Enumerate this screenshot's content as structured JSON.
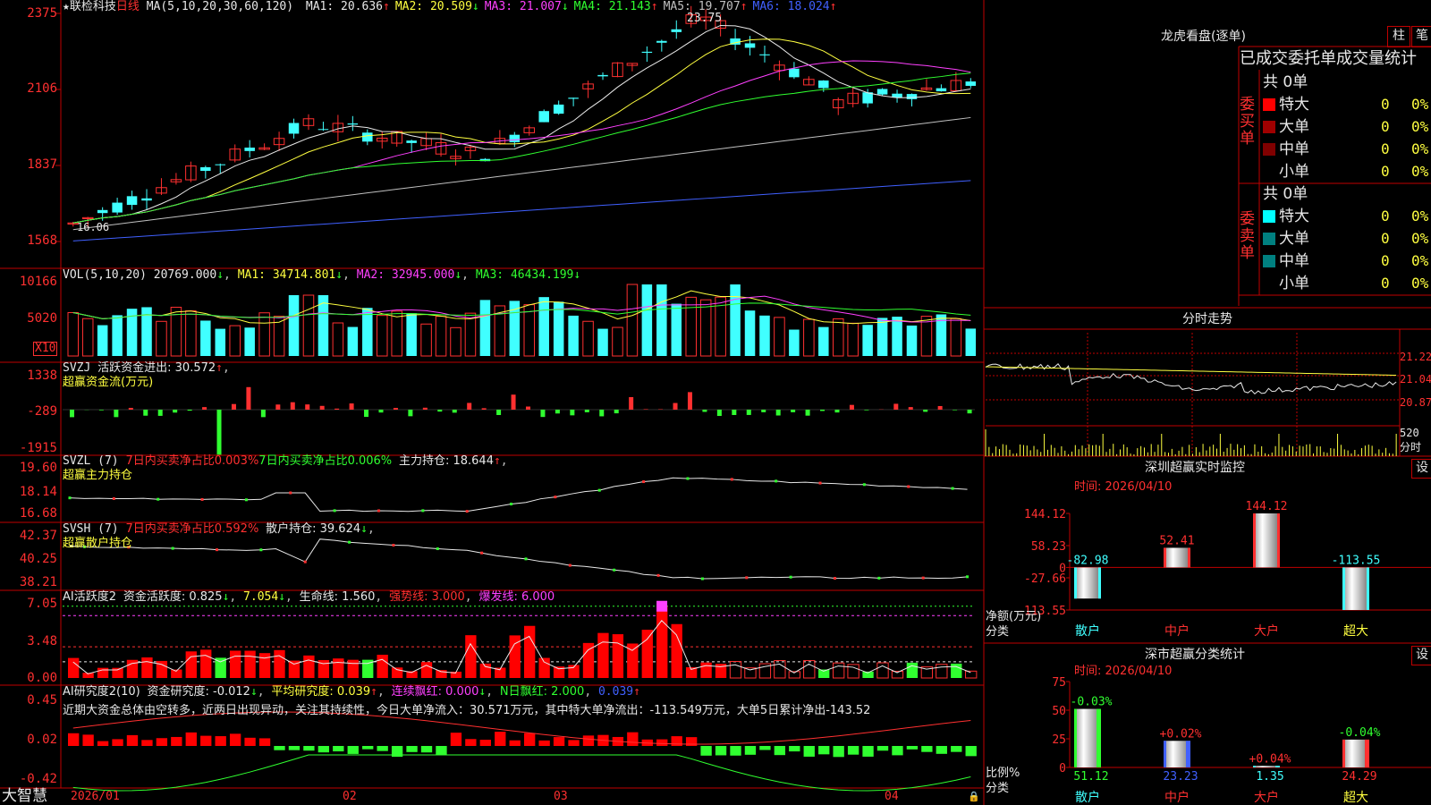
{
  "stock": {
    "star": "★",
    "name": "联检科技",
    "period": "日线",
    "ma_title": "MA(5,10,20,30,60,120)",
    "ma": [
      {
        "label": "MA1: 20.636",
        "arrow": "↑",
        "color": "#e8e8e8"
      },
      {
        "label": "MA2: 20.509",
        "arrow": "↓",
        "color": "#ffff40"
      },
      {
        "label": "MA3: 21.007",
        "arrow": "↓",
        "color": "#ff40ff"
      },
      {
        "label": "MA4: 21.143",
        "arrow": "↑",
        "color": "#30ff30"
      },
      {
        "label": "MA5: 19.707",
        "arrow": "↑",
        "color": "#c0c0c0"
      },
      {
        "label": "MA6: 18.024",
        "arrow": "↑",
        "color": "#4060ff"
      }
    ],
    "high_label": "23.75",
    "low_label": "16.06"
  },
  "vol": {
    "title": "VOL(5,10,20)",
    "value": "20769.000",
    "value_arrow": "↓",
    "ma1": "MA1: 34714.801",
    "ma1_arrow": "↓",
    "ma2": "MA2: 32945.000",
    "ma2_arrow": "↓",
    "ma3": "MA3: 46434.199",
    "ma3_arrow": "↓",
    "unit": "X10"
  },
  "svzj": {
    "title": "SVZJ",
    "label": "活跃资金进出: 30.572",
    "arrow": "↑",
    "sub": "超赢资金流(万元)"
  },
  "svzl": {
    "title": "SVZL (7)",
    "t1": "7日内买卖净占比0.003%",
    "t2": "7日内买卖净占比0.006%",
    "t3": "主力持仓: 18.644",
    "arrow": "↑",
    "sub": "超赢主力持仓"
  },
  "svsh": {
    "title": "SVSH (7)",
    "t1": "7日内买卖净占比0.592%",
    "t2": "散户持仓: 39.624",
    "arrow": "↓",
    "sub": "超赢散户持仓"
  },
  "ai1": {
    "title": "AI活跃度2",
    "t1": "资金活跃度: 0.825",
    "a1": "↓",
    "t2": "7.054",
    "a2": "↓",
    "t3": "生命线: 1.560",
    "t4": "强势线: 3.000",
    "t5": "爆发线: 6.000"
  },
  "ai2": {
    "title": "AI研究度2(10)",
    "t1": "资金研究度: -0.012",
    "a1": "↓",
    "t2": "平均研究度: 0.039",
    "a2": "↑",
    "t3": "连续飘红: 0.000",
    "a3": "↓",
    "t4": "N日飘红: 2.000",
    "t5": "0.039",
    "a5": "↑",
    "desc": "近期大资金总体由空转多，近两日出现异动，关注其持续性，今日大单净流入：30.571万元，其中特大单净流出：-113.549万元，大单5日累计净出-143.52"
  },
  "axes": {
    "price": [
      "2375",
      "2106",
      "1837",
      "1568"
    ],
    "vol": [
      "10166",
      "5020"
    ],
    "svzj": [
      "1338",
      "-289",
      "-1915"
    ],
    "svzl": [
      "19.60",
      "18.14",
      "16.68"
    ],
    "svsh": [
      "42.37",
      "40.25",
      "38.21"
    ],
    "ai1": [
      "7.05",
      "3.48",
      "0.00"
    ],
    "ai2": [
      "0.45",
      "0.02",
      "-0.42"
    ]
  },
  "dates": {
    "d1": "2026/01",
    "d2": "02",
    "d3": "03",
    "d4": "04"
  },
  "brand": "大智慧",
  "right": {
    "lhb_title": "龙虎看盘(逐单)",
    "btn_zhu": "柱",
    "btn_bi": "笔",
    "table_title": "已成交委托单成交量统计",
    "buy_side": "委买单",
    "sell_side": "委卖单",
    "buy_total": "共 0单",
    "sell_total": "共 0单",
    "buy_rows": [
      {
        "label": "特大",
        "count": "0",
        "pct": "0%",
        "color": "#ff0000"
      },
      {
        "label": "大单",
        "count": "0",
        "pct": "0%",
        "color": "#a00000"
      },
      {
        "label": "中单",
        "count": "0",
        "pct": "0%",
        "color": "#800000"
      },
      {
        "label": "小单",
        "count": "0",
        "pct": "0%",
        "color": ""
      }
    ],
    "sell_rows": [
      {
        "label": "特大",
        "count": "0",
        "pct": "0%",
        "color": "#00ffff"
      },
      {
        "label": "大单",
        "count": "0",
        "pct": "0%",
        "color": "#008080"
      },
      {
        "label": "中单",
        "count": "0",
        "pct": "0%",
        "color": "#008080"
      },
      {
        "label": "小单",
        "count": "0",
        "pct": "0%",
        "color": ""
      }
    ],
    "fs_title": "分时走势",
    "fs_axis": [
      "21.22",
      "21.04",
      "20.87"
    ],
    "fs_vol": "520",
    "fs_vol_unit": "分时",
    "sz_title": "深圳超赢实时监控",
    "set": "设",
    "sz_time": "时间: 2026/04/10",
    "sz_axis": [
      "144.12",
      "58.23",
      "0",
      "-27.66",
      "-113.55"
    ],
    "sz_ylabel": "净额(万元)",
    "sz_xlabel": "分类",
    "sc_title": "深市超赢分类统计",
    "sc_time": "时间: 2026/04/10",
    "sc_axis": [
      "75",
      "50",
      "25",
      "0"
    ],
    "sc_ylabel": "比例%",
    "sc_xlabel": "分类"
  },
  "chart_data": [
    {
      "type": "bar",
      "title": "深圳超赢实时监控",
      "ylabel": "净额(万元)",
      "xlabel": "分类",
      "categories": [
        "散户",
        "中户",
        "大户",
        "超大"
      ],
      "values": [
        -82.98,
        52.41,
        144.12,
        -113.55
      ],
      "value_labels": [
        "-82.98",
        "52.41",
        "144.12",
        "-113.55"
      ],
      "ylim": [
        -113.55,
        144.12
      ]
    },
    {
      "type": "bar",
      "title": "深市超赢分类统计",
      "ylabel": "比例%",
      "xlabel": "分类",
      "categories": [
        "散户",
        "中户",
        "大户",
        "超大"
      ],
      "values": [
        51.12,
        23.23,
        1.35,
        24.29
      ],
      "value_labels": [
        "51.12",
        "23.23",
        "1.35",
        "24.29"
      ],
      "change_labels": [
        "-0.03%",
        "+0.02%",
        "+0.04%",
        "-0.04%"
      ],
      "colors": [
        "#30ff30",
        "#4060ff",
        "#40ffff",
        "#ff3030"
      ],
      "ylim": [
        0,
        75
      ]
    }
  ]
}
